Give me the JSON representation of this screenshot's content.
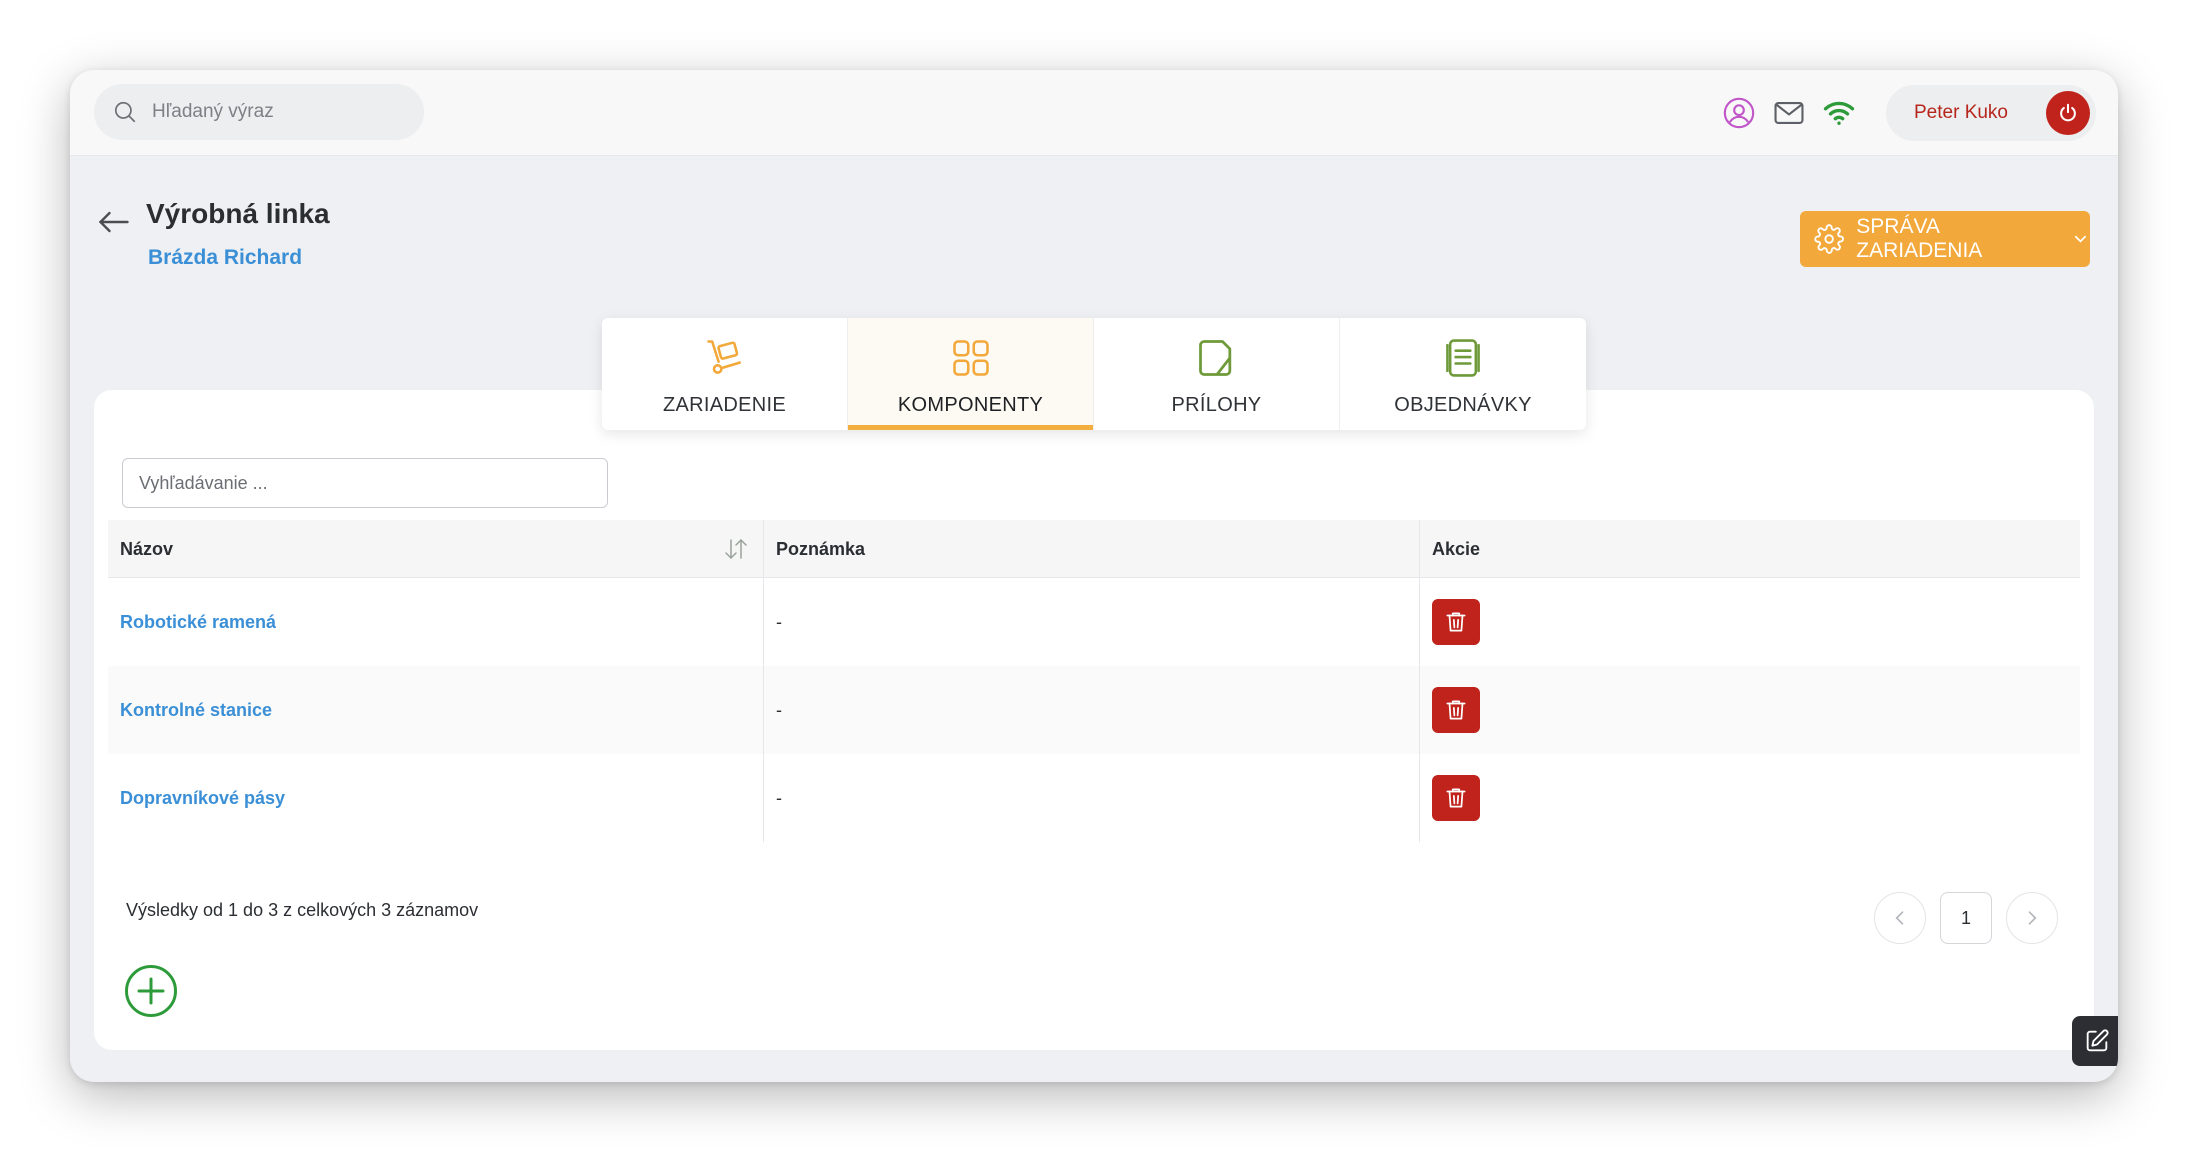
{
  "header": {
    "search_placeholder": "Hľadaný výraz",
    "user_name": "Peter Kuko",
    "icons": [
      "user-circle-icon",
      "mail-icon",
      "wifi-icon",
      "power-icon"
    ]
  },
  "page": {
    "title": "Výrobná linka",
    "subtitle": "Brázda Richard",
    "manage_button": "SPRÁVA ZARIADENIA"
  },
  "tabs": [
    {
      "label": "ZARIADENIE",
      "icon": "hand-truck-icon",
      "active": false
    },
    {
      "label": "KOMPONENTY",
      "icon": "grid-icon",
      "active": true
    },
    {
      "label": "PRÍLOHY",
      "icon": "document-icon",
      "active": false
    },
    {
      "label": "OBJEDNÁVKY",
      "icon": "orders-icon",
      "active": false
    }
  ],
  "list": {
    "search_placeholder": "Vyhľadávanie ...",
    "columns": [
      "Názov",
      "Poznámka",
      "Akcie"
    ],
    "rows": [
      {
        "name": "Robotické ramená",
        "note": "-"
      },
      {
        "name": "Kontrolné stanice",
        "note": "-"
      },
      {
        "name": "Dopravníkové pásy",
        "note": "-"
      }
    ],
    "results_text": "Výsledky od 1 do 3 z celkových 3 záznamov",
    "current_page": "1"
  },
  "colors": {
    "accent_orange": "#f2a83a",
    "link_blue": "#3a8fd6",
    "danger_red": "#c0231b",
    "success_green": "#2e9b3a"
  }
}
